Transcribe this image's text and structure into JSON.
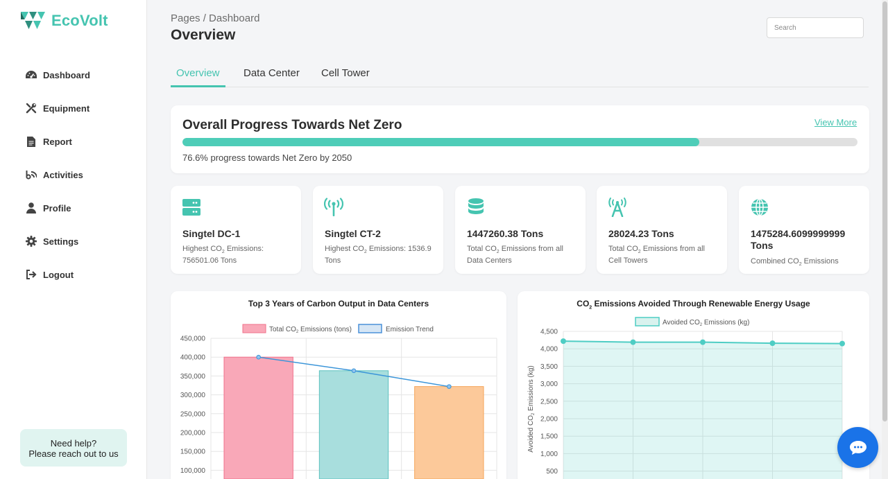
{
  "app": {
    "name": "EcoVolt"
  },
  "sidebar": {
    "items": [
      {
        "label": "Dashboard",
        "icon": "gauge-icon"
      },
      {
        "label": "Equipment",
        "icon": "tools-icon"
      },
      {
        "label": "Report",
        "icon": "document-icon"
      },
      {
        "label": "Activities",
        "icon": "activity-icon"
      },
      {
        "label": "Profile",
        "icon": "user-icon"
      },
      {
        "label": "Settings",
        "icon": "gear-icon"
      },
      {
        "label": "Logout",
        "icon": "logout-icon"
      }
    ],
    "help": {
      "line1": "Need help?",
      "line2": "Please reach out to us"
    }
  },
  "header": {
    "breadcrumb": "Pages / Dashboard",
    "title": "Overview",
    "search_placeholder": "Search"
  },
  "tabs": [
    {
      "label": "Overview",
      "active": true
    },
    {
      "label": "Data Center",
      "active": false
    },
    {
      "label": "Cell Tower",
      "active": false
    }
  ],
  "progress": {
    "title": "Overall Progress Towards Net Zero",
    "view_more": "View More",
    "percent": 76.6,
    "text": "76.6% progress towards Net Zero by 2050"
  },
  "stats": [
    {
      "icon": "server-icon",
      "value": "Singtel DC-1",
      "sub_pre": "Highest CO",
      "sub_post": " Emissions: 756501.06 Tons"
    },
    {
      "icon": "antenna-icon",
      "value": "Singtel CT-2",
      "sub_pre": "Highest CO",
      "sub_post": " Emissions: 1536.9 Tons"
    },
    {
      "icon": "database-icon",
      "value": "1447260.38 Tons",
      "sub_pre": "Total CO",
      "sub_post": " Emissions from all Data Centers"
    },
    {
      "icon": "tower-icon",
      "value": "28024.23 Tons",
      "sub_pre": "Total CO",
      "sub_post": " Emissions from all Cell Towers"
    },
    {
      "icon": "globe-icon",
      "value": "1475284.6099999999 Tons",
      "sub_pre": "Combined CO",
      "sub_post": " Emissions"
    }
  ],
  "colors": {
    "accent": "#45c4b0",
    "fab": "#1a73e8"
  },
  "chart_data": [
    {
      "type": "bar",
      "title": "Top 3 Years of Carbon Output in Data Centers",
      "legend": [
        "Total CO2 Emissions (tons)",
        "Emission Trend"
      ],
      "legend_placement": "top",
      "series": [
        {
          "name": "Total CO2 Emissions (tons)",
          "values": [
            400000,
            364000,
            322000
          ]
        },
        {
          "name": "Emission Trend",
          "type": "line",
          "values": [
            400000,
            364000,
            322000
          ]
        }
      ],
      "yticks": [
        "450,000",
        "400,000",
        "350,000",
        "300,000",
        "250,000",
        "200,000",
        "150,000",
        "100,000"
      ],
      "ylim": [
        100000,
        450000
      ],
      "grid": true
    },
    {
      "type": "area",
      "title": "CO2 Emissions Avoided Through Renewable Energy Usage",
      "legend": [
        "Avoided CO2 Emissions (kg)"
      ],
      "legend_placement": "top",
      "ylabel": "Avoided CO2 Emissions (kg)",
      "series": [
        {
          "name": "Avoided CO2 Emissions (kg)",
          "values": [
            4220,
            4190,
            4190,
            4160,
            4150
          ]
        }
      ],
      "yticks": [
        "4,500",
        "4,000",
        "3,500",
        "3,000",
        "2,500",
        "2,000",
        "1,500",
        "1,000",
        "500"
      ],
      "ylim": [
        500,
        4500
      ],
      "grid": true
    }
  ]
}
